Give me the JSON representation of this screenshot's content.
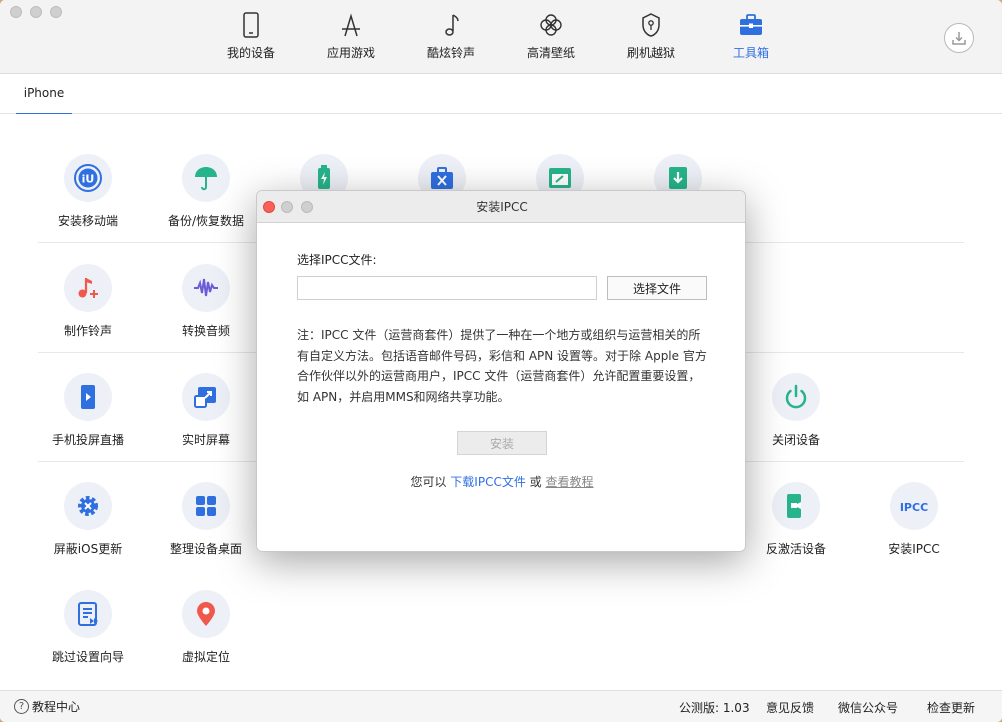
{
  "nav": {
    "items": [
      {
        "label": "我的设备",
        "icon": "phone-icon"
      },
      {
        "label": "应用游戏",
        "icon": "appstore-icon"
      },
      {
        "label": "酷炫铃声",
        "icon": "music-note-icon"
      },
      {
        "label": "高清壁纸",
        "icon": "flower-icon"
      },
      {
        "label": "刷机越狱",
        "icon": "shield-key-icon"
      },
      {
        "label": "工具箱",
        "icon": "toolbox-icon"
      }
    ],
    "active_index": 5,
    "download_icon": "download-icon"
  },
  "tabs": [
    {
      "label": "iPhone"
    }
  ],
  "tools": {
    "row1": [
      {
        "label": "安装移动端",
        "icon": "iu-app-icon"
      },
      {
        "label": "备份/恢复数据",
        "icon": "umbrella-icon"
      },
      {
        "label": "",
        "icon": "battery-icon"
      },
      {
        "label": "",
        "icon": "repair-kit-icon"
      },
      {
        "label": "",
        "icon": "screen-tool-icon"
      },
      {
        "label": "",
        "icon": "download-box-icon"
      }
    ],
    "row2": [
      {
        "label": "制作铃声",
        "icon": "music-plus-icon"
      },
      {
        "label": "转换音频",
        "icon": "waveform-icon"
      }
    ],
    "row3": [
      {
        "label": "手机投屏直播",
        "icon": "phone-play-icon"
      },
      {
        "label": "实时屏幕",
        "icon": "screen-expand-icon"
      },
      {
        "label": "关闭设备",
        "icon": "power-icon"
      }
    ],
    "row4": [
      {
        "label": "屏蔽iOS更新",
        "icon": "gear-block-icon"
      },
      {
        "label": "整理设备桌面",
        "icon": "grid-icon"
      },
      {
        "label": "反激活设备",
        "icon": "phone-video-icon"
      },
      {
        "label": "安装IPCC",
        "icon": "ipcc-icon",
        "icon_text": "IPCC"
      }
    ],
    "row5": [
      {
        "label": "跳过设置向导",
        "icon": "checklist-icon"
      },
      {
        "label": "虚拟定位",
        "icon": "location-pin-icon"
      }
    ]
  },
  "status": {
    "help": "教程中心",
    "version": "公测版: 1.03",
    "feedback": "意见反馈",
    "wechat": "微信公众号",
    "update": "检查更新"
  },
  "dialog": {
    "title": "安装IPCC",
    "file_label": "选择IPCC文件:",
    "file_value": "",
    "choose_button": "选择文件",
    "note_lines": [
      "注：IPCC 文件（运营商套件）提供了一种在一个地方或组织与运营相关的所",
      "有自定义方法。包括语音邮件号码，彩信和 APN 设置等。对于除 Apple 官方",
      "合作伙伴以外的运营商用户，IPCC 文件（运营商套件）允许配置重要设置，",
      "如 APN，并启用MMS和网络共享功能。"
    ],
    "install_button": "安装",
    "links_prefix": "您可以",
    "download_link": "下载IPCC文件",
    "links_or": "或",
    "tutorial_link": "查看教程"
  },
  "colors": {
    "accent": "#2f6fe0",
    "icon_blue": "#2f6fe0",
    "icon_green": "#27b48a",
    "icon_red": "#f0584c",
    "icon_purple": "#6b5bd6"
  }
}
